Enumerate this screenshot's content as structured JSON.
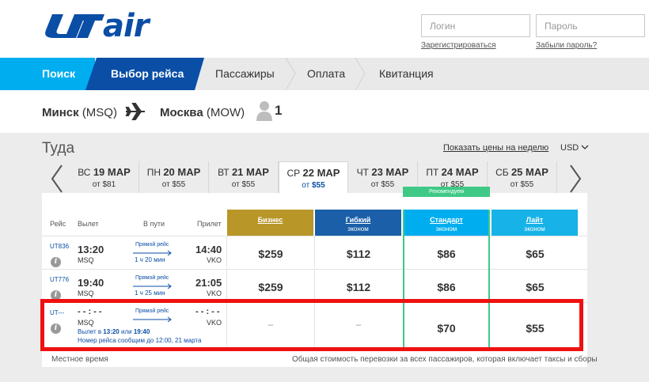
{
  "brand": {
    "logo_text": "air",
    "brand_color": "#0a4ea6"
  },
  "login": {
    "login_placeholder": "Логин",
    "password_placeholder": "Пароль",
    "register_link": "Зарегистрироваться",
    "forgot_link": "Забыли пароль?"
  },
  "nav": {
    "search": "Поиск",
    "select_flight": "Выбор рейса",
    "passengers": "Пассажиры",
    "payment": "Оплата",
    "receipt": "Квитанция"
  },
  "route": {
    "from_city": "Минск",
    "from_code": "(MSQ)",
    "to_city": "Москва",
    "to_code": "(MOW)",
    "passengers": "1"
  },
  "direction": {
    "title": "Туда",
    "week_link": "Показать цены на неделю",
    "currency": "USD"
  },
  "dates": [
    {
      "dow": "ВС",
      "date": "19 МАР",
      "price_prefix": "от ",
      "price": "$81"
    },
    {
      "dow": "ПН",
      "date": "20 МАР",
      "price_prefix": "от ",
      "price": "$55"
    },
    {
      "dow": "ВТ",
      "date": "21 МАР",
      "price_prefix": "от ",
      "price": "$55"
    },
    {
      "dow": "СР",
      "date": "22 МАР",
      "price_prefix": "от ",
      "price": "$55",
      "active": true
    },
    {
      "dow": "ЧТ",
      "date": "23 МАР",
      "price_prefix": "от ",
      "price": "$55"
    },
    {
      "dow": "ПТ",
      "date": "24 МАР",
      "price_prefix": "от ",
      "price": "$55"
    },
    {
      "dow": "СБ",
      "date": "25 МАР",
      "price_prefix": "от ",
      "price": "$55"
    }
  ],
  "table": {
    "recommended": "Рекомендуем",
    "headers": {
      "flight": "Рейс",
      "departure": "Вылет",
      "en_route": "В пути",
      "arrival": "Прилет"
    },
    "fares": [
      {
        "name": "Бизнес",
        "sub": ""
      },
      {
        "name": "Гибкий",
        "sub": "эконом"
      },
      {
        "name": "Стандарт",
        "sub": "эконом"
      },
      {
        "name": "Лайт",
        "sub": "эконом"
      }
    ],
    "rows": [
      {
        "flight": "UT836",
        "dep_time": "13:20",
        "dep_airport": "MSQ",
        "type": "Прямой рейс",
        "duration": "1 ч 20 мин",
        "arr_time": "14:40",
        "arr_airport": "VKO",
        "prices": [
          "$259",
          "$112",
          "$86",
          "$65"
        ]
      },
      {
        "flight": "UT776",
        "dep_time": "19:40",
        "dep_airport": "MSQ",
        "type": "Прямой рейс",
        "duration": "1 ч 25 мин",
        "arr_time": "21:05",
        "arr_airport": "VKO",
        "prices": [
          "$259",
          "$112",
          "$86",
          "$65"
        ]
      },
      {
        "flight": "UT---",
        "dep_time": "- - : - -",
        "dep_airport": "MSQ",
        "type": "Прямой рейс",
        "duration": "",
        "arr_time": "- - : - -",
        "arr_airport": "VKO",
        "prices": [
          "–",
          "–",
          "$70",
          "$55"
        ],
        "note_1_prefix": "Вылет в ",
        "note_1_t1": "13:20",
        "note_1_mid": " или ",
        "note_1_t2": "19:40",
        "note_2": "Номер рейса сообщим до 12:00, 21 марта"
      }
    ]
  },
  "footer": {
    "local_time": "Местное время",
    "total_note": "Общая стоимость перевозки за всех пассажиров, которая включает таксы и сборы"
  }
}
